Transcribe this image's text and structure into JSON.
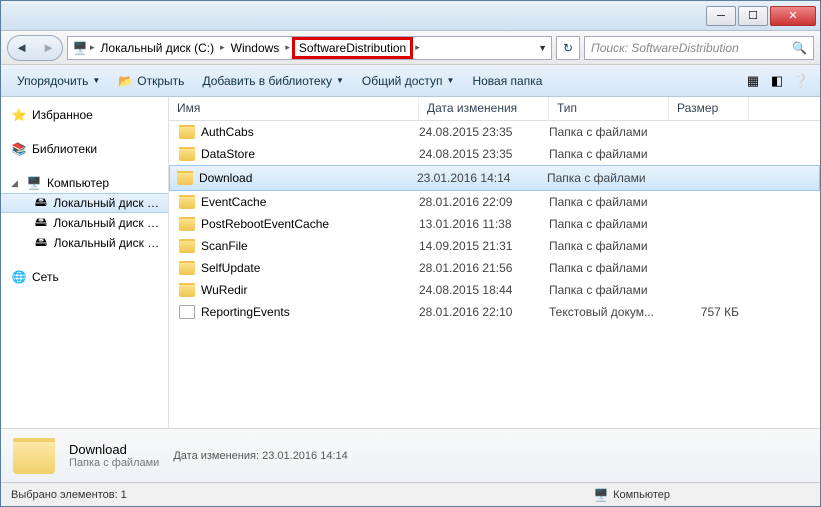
{
  "breadcrumb": {
    "root_icon": "computer",
    "items": [
      "Локальный диск (C:)",
      "Windows",
      "SoftwareDistribution"
    ],
    "highlight_index": 2
  },
  "search": {
    "placeholder": "Поиск: SoftwareDistribution"
  },
  "toolbar": {
    "organize": "Упорядочить",
    "open": "Открыть",
    "add_library": "Добавить в библиотеку",
    "share": "Общий доступ",
    "new_folder": "Новая папка"
  },
  "sidebar": {
    "favorites": "Избранное",
    "libraries": "Библиотеки",
    "computer": "Компьютер",
    "drives": [
      "Локальный диск (C:)",
      "Локальный диск (D:)",
      "Локальный диск (F:)"
    ],
    "network": "Сеть"
  },
  "columns": {
    "name": "Имя",
    "date": "Дата изменения",
    "type": "Тип",
    "size": "Размер"
  },
  "rows": [
    {
      "name": "AuthCabs",
      "date": "24.08.2015 23:35",
      "type": "Папка с файлами",
      "size": "",
      "icon": "folder"
    },
    {
      "name": "DataStore",
      "date": "24.08.2015 23:35",
      "type": "Папка с файлами",
      "size": "",
      "icon": "folder"
    },
    {
      "name": "Download",
      "date": "23.01.2016 14:14",
      "type": "Папка с файлами",
      "size": "",
      "icon": "folder",
      "selected": true,
      "highlight": true
    },
    {
      "name": "EventCache",
      "date": "28.01.2016 22:09",
      "type": "Папка с файлами",
      "size": "",
      "icon": "folder"
    },
    {
      "name": "PostRebootEventCache",
      "date": "13.01.2016 11:38",
      "type": "Папка с файлами",
      "size": "",
      "icon": "folder"
    },
    {
      "name": "ScanFile",
      "date": "14.09.2015 21:31",
      "type": "Папка с файлами",
      "size": "",
      "icon": "folder"
    },
    {
      "name": "SelfUpdate",
      "date": "28.01.2016 21:56",
      "type": "Папка с файлами",
      "size": "",
      "icon": "folder"
    },
    {
      "name": "WuRedir",
      "date": "24.08.2015 18:44",
      "type": "Папка с файлами",
      "size": "",
      "icon": "folder"
    },
    {
      "name": "ReportingEvents",
      "date": "28.01.2016 22:10",
      "type": "Текстовый докум...",
      "size": "757 КБ",
      "icon": "txt"
    }
  ],
  "details": {
    "name": "Download",
    "type": "Папка с файлами",
    "meta_label": "Дата изменения:",
    "meta_value": "23.01.2016 14:14"
  },
  "status": {
    "left": "Выбрано элементов: 1",
    "right": "Компьютер"
  }
}
